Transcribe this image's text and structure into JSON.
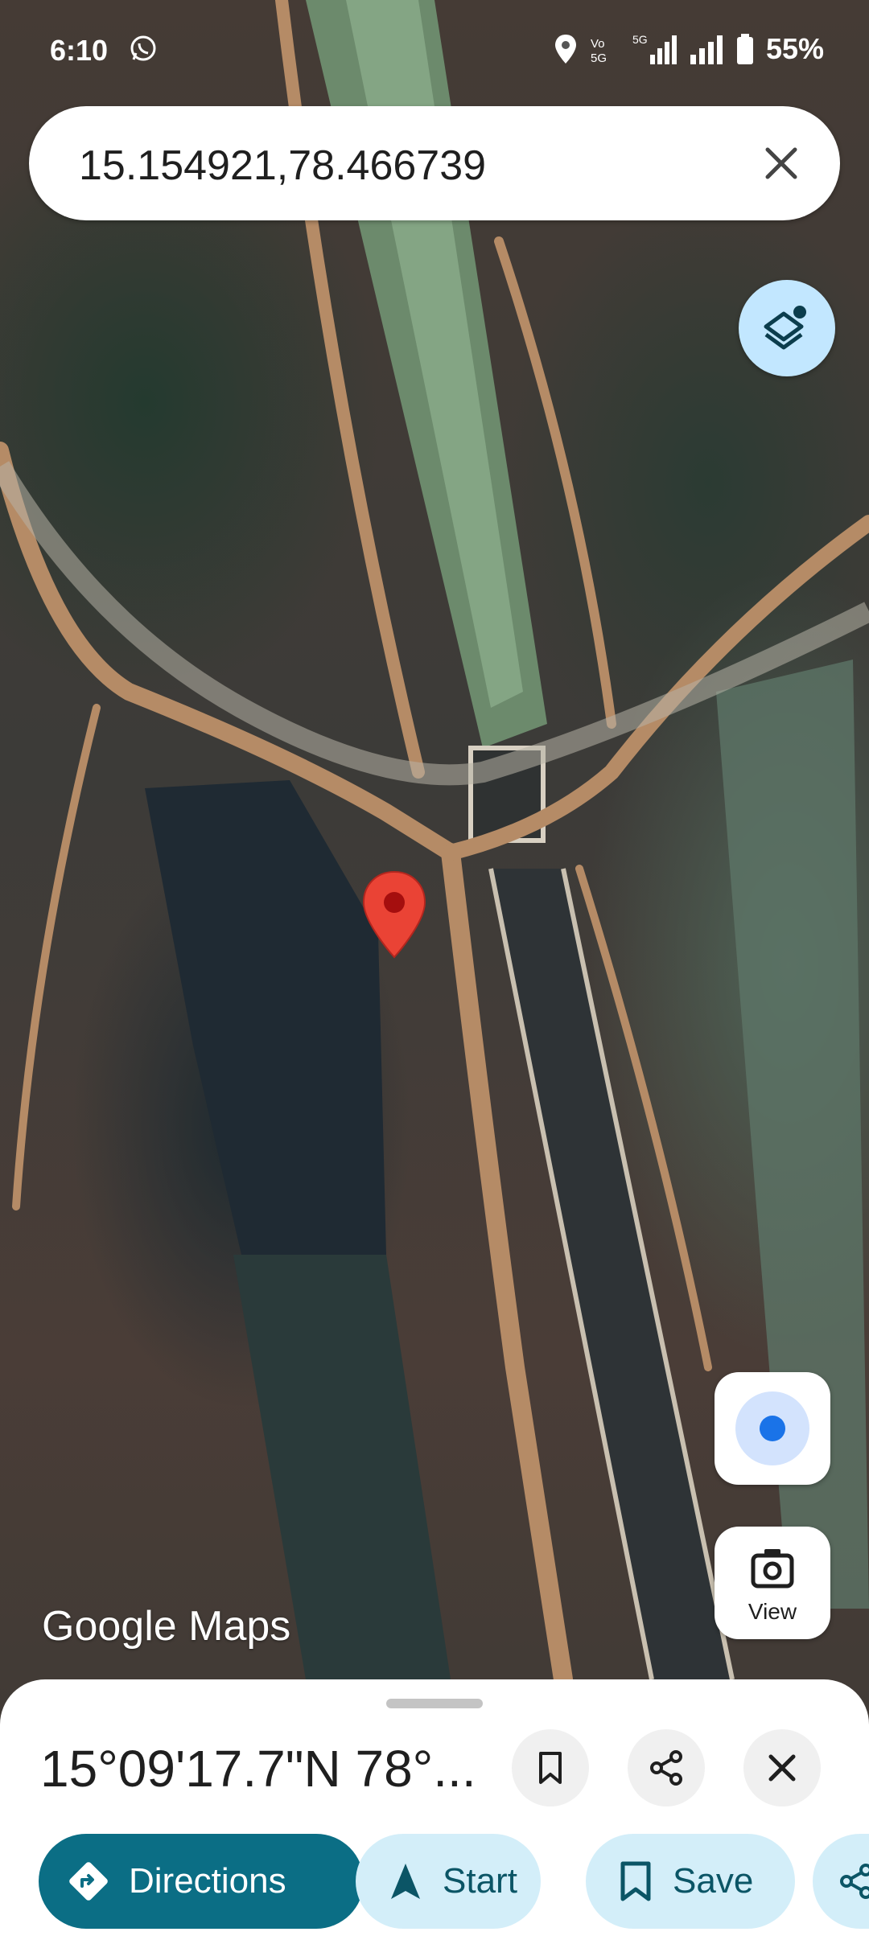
{
  "status_bar": {
    "time": "6:10",
    "battery": "55%",
    "icons": [
      "whatsapp-icon",
      "location-icon",
      "volte-icon",
      "5g-signal-icon",
      "signal-icon",
      "battery-icon"
    ]
  },
  "search": {
    "query": "15.154921,78.466739",
    "clear_icon": "close-icon"
  },
  "map": {
    "type": "satellite",
    "watermark": "Google Maps",
    "marker_icon": "red-pin-icon",
    "layers_icon": "layers-icon",
    "my_location_icon": "my-location-icon",
    "view_button": {
      "label": "View",
      "icon": "street-view-camera-icon"
    }
  },
  "bottom_sheet": {
    "title": "15°09'17.7\"N 78°...",
    "actions": [
      {
        "icon": "bookmark-icon"
      },
      {
        "icon": "share-icon"
      },
      {
        "icon": "close-icon"
      }
    ],
    "chips": [
      {
        "label": "Directions",
        "icon": "directions-icon"
      },
      {
        "label": "Start",
        "icon": "navigation-arrow-icon"
      },
      {
        "label": "Save",
        "icon": "bookmark-icon"
      },
      {
        "label": "",
        "icon": "share-icon"
      }
    ]
  },
  "colors": {
    "primary": "#0b6e85",
    "tonal_chip": "#d3eef9",
    "layers_button": "#c2e7ff",
    "location_dot": "#1a73e8",
    "pin": "#ea4335"
  }
}
